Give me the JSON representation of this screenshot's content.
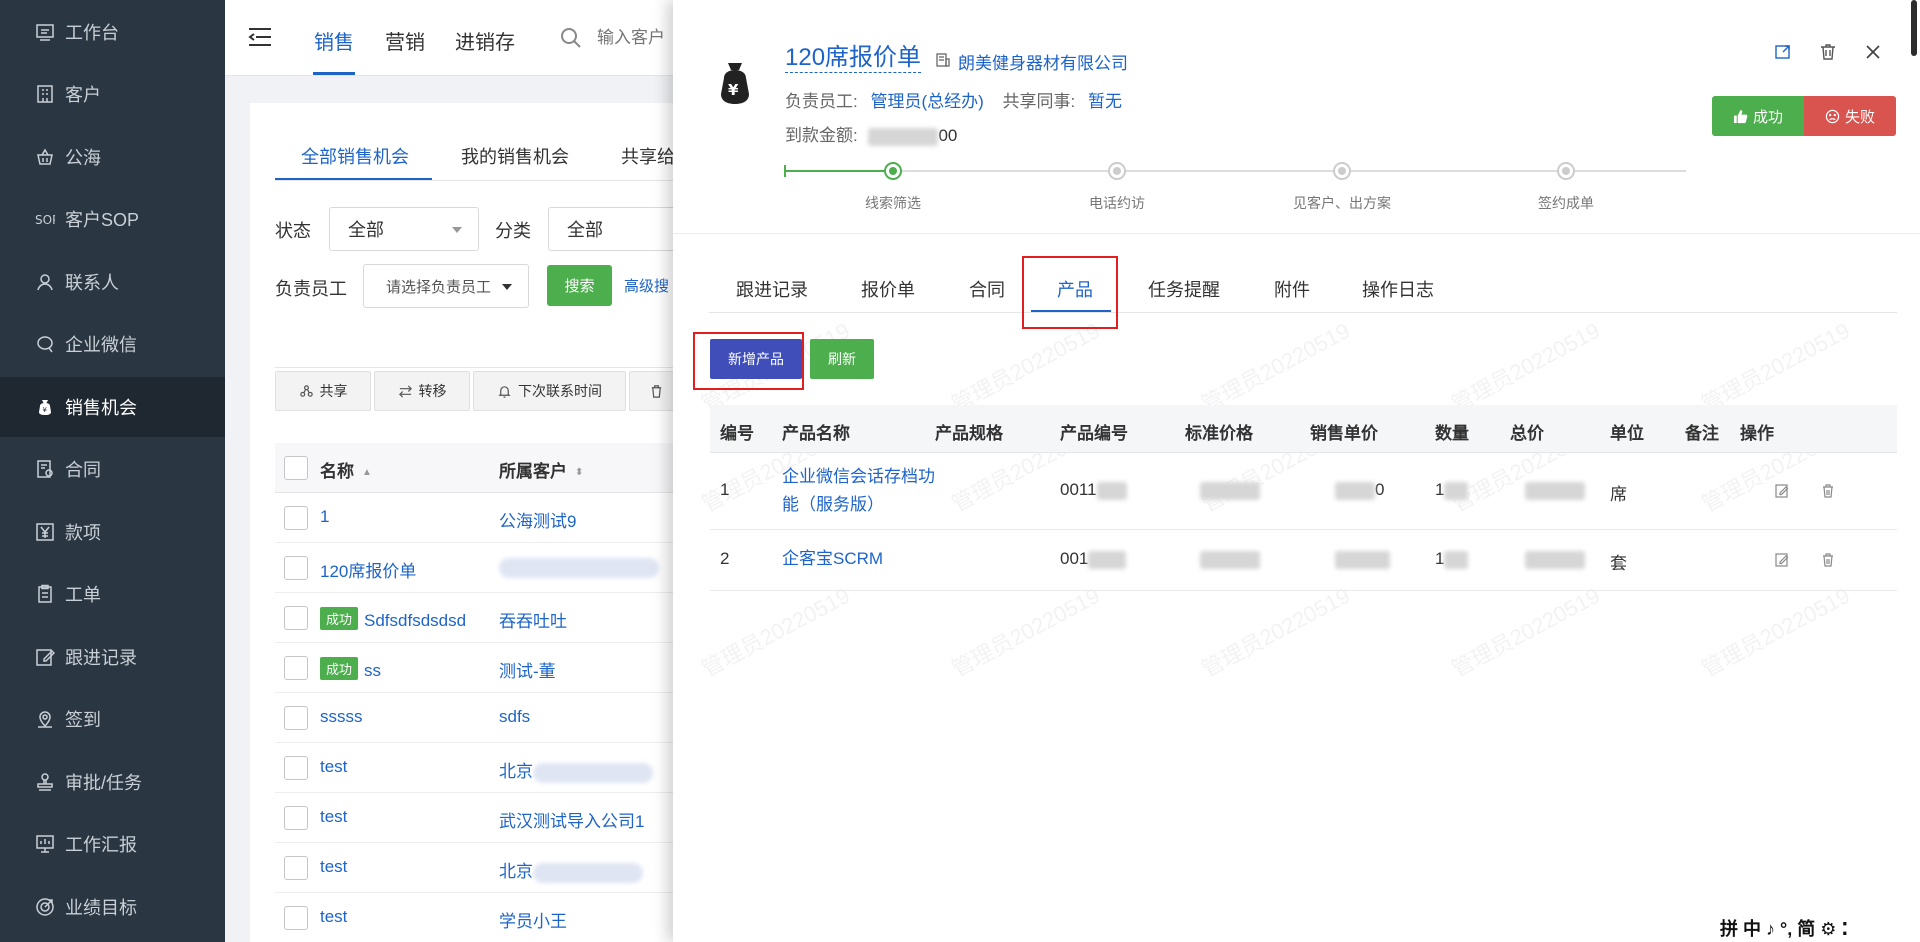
{
  "sidebar": {
    "items": [
      {
        "label": "工作台",
        "icon": "dashboard-icon"
      },
      {
        "label": "客户",
        "icon": "building-icon"
      },
      {
        "label": "公海",
        "icon": "basket-icon"
      },
      {
        "label": "客户SOP",
        "icon": "sop-icon"
      },
      {
        "label": "联系人",
        "icon": "person-icon"
      },
      {
        "label": "企业微信",
        "icon": "chat-icon"
      },
      {
        "label": "销售机会",
        "icon": "money-bag-icon"
      },
      {
        "label": "合同",
        "icon": "contract-icon"
      },
      {
        "label": "款项",
        "icon": "yen-icon"
      },
      {
        "label": "工单",
        "icon": "clipboard-icon"
      },
      {
        "label": "跟进记录",
        "icon": "edit-icon"
      },
      {
        "label": "签到",
        "icon": "location-icon"
      },
      {
        "label": "审批/任务",
        "icon": "stamp-icon"
      },
      {
        "label": "工作汇报",
        "icon": "report-icon"
      },
      {
        "label": "业绩目标",
        "icon": "target-icon"
      }
    ]
  },
  "topbar": {
    "tabs": [
      "销售",
      "营销",
      "进销存"
    ],
    "search_placeholder": "输入客户"
  },
  "list": {
    "tabs": [
      "全部销售机会",
      "我的销售机会",
      "共享给"
    ],
    "filters": {
      "status_label": "状态",
      "status_value": "全部",
      "category_label": "分类",
      "category_value": "全部",
      "owner_label": "负责员工",
      "owner_placeholder": "请选择负责员工"
    },
    "search_btn": "搜索",
    "advanced_link": "高级搜",
    "actions": [
      "共享",
      "转移",
      "下次联系时间"
    ],
    "columns": [
      "名称",
      "所属客户"
    ],
    "rows": [
      {
        "name": "1",
        "customer": "公海测试9"
      },
      {
        "name": "120席报价单",
        "customer": ""
      },
      {
        "name": "Sdfsdfsdsdsd",
        "customer": "吞吞吐吐",
        "badge": "成功"
      },
      {
        "name": "ss",
        "customer": "测试-董",
        "badge": "成功"
      },
      {
        "name": "sssss",
        "customer": "sdfs"
      },
      {
        "name": "test",
        "customer": "北京"
      },
      {
        "name": "test",
        "customer": "武汉测试导入公司1"
      },
      {
        "name": "test",
        "customer": "北京"
      },
      {
        "name": "test",
        "customer": "学员小王"
      }
    ]
  },
  "drawer": {
    "title": "120席报价单",
    "company": "朗美健身器材有限公司",
    "owner_label": "负责员工:",
    "owner_value": "管理员(总经办)",
    "share_label": "共享同事:",
    "share_value": "暂无",
    "amount_label": "到款金额:",
    "amount_suffix": "00",
    "btn_success": "成功",
    "btn_fail": "失败",
    "stages": [
      "线索筛选",
      "电话约访",
      "见客户、出方案",
      "签约成单"
    ],
    "current_stage": 1,
    "tabs": [
      "跟进记录",
      "报价单",
      "合同",
      "产品",
      "任务提醒",
      "附件",
      "操作日志"
    ],
    "active_tab": "产品",
    "btn_add_product": "新增产品",
    "btn_refresh": "刷新",
    "product_columns": [
      "编号",
      "产品名称",
      "产品规格",
      "产品编号",
      "标准价格",
      "销售单价",
      "数量",
      "总价",
      "单位",
      "备注",
      "操作"
    ],
    "products": [
      {
        "no": "1",
        "name": "企业微信会话存档功能（服务版）",
        "code": "0011",
        "price_tail": "0",
        "qty_head": "1",
        "unit": "席"
      },
      {
        "no": "2",
        "name": "企客宝SCRM",
        "code": "001",
        "price_tail": "",
        "qty_head": "1",
        "unit": "套"
      }
    ],
    "watermark": "管理员20220519"
  },
  "ime": {
    "text": "拼 中 ♪ °, 简 ⚙ ⁚"
  }
}
